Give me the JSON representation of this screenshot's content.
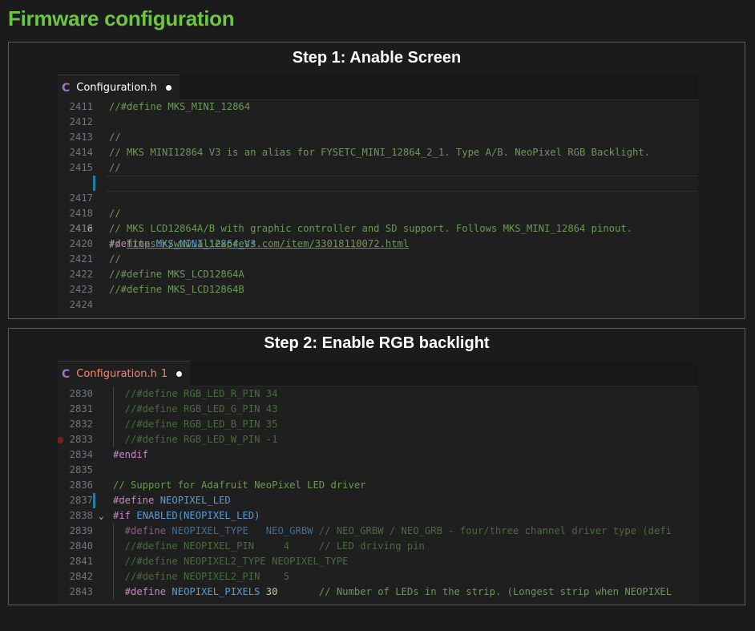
{
  "page_title": "Firmware configuration",
  "steps": [
    {
      "title": "Step 1: Anable Screen",
      "tab": {
        "icon": "C",
        "label": "Configuration.h",
        "badge": ""
      },
      "lines": [
        {
          "n": "2411",
          "t": "//#define MKS_MINI_12864"
        },
        {
          "n": "2412",
          "t": ""
        },
        {
          "n": "2413",
          "t": "//"
        },
        {
          "n": "2414",
          "t": "// MKS MINI12864 V3 is an alias for FYSETC_MINI_12864_2_1. Type A/B. NeoPixel RGB Backlight."
        },
        {
          "n": "2415",
          "t": "//"
        },
        {
          "n": "2416",
          "kw": "#define",
          "mac": "MKS_MINI_12864_V3"
        },
        {
          "n": "2417",
          "t": ""
        },
        {
          "n": "2418",
          "t": "//"
        },
        {
          "n": "2419",
          "t": "// MKS LCD12864A/B with graphic controller and SD support. Follows MKS_MINI_12864 pinout."
        },
        {
          "n": "2420",
          "pre": "// ",
          "link": "https://www.aliexpress.com/item/33018110072.html"
        },
        {
          "n": "2421",
          "t": "//"
        },
        {
          "n": "2422",
          "t": "//#define MKS_LCD12864A"
        },
        {
          "n": "2423",
          "t": "//#define MKS_LCD12864B"
        },
        {
          "n": "2424",
          "t": ""
        }
      ]
    },
    {
      "title": "Step 2: Enable RGB backlight",
      "tab": {
        "icon": "C",
        "label": "Configuration.h",
        "badge": "1"
      },
      "lines": [
        {
          "n": "2830",
          "t": "  //#define RGB_LED_R_PIN 34"
        },
        {
          "n": "2831",
          "t": "  //#define RGB_LED_G_PIN 43"
        },
        {
          "n": "2832",
          "t": "  //#define RGB_LED_B_PIN 35"
        },
        {
          "n": "2833",
          "t": "  //#define RGB_LED_W_PIN -1"
        },
        {
          "n": "2834",
          "kw": "#endif"
        },
        {
          "n": "2835",
          "t": ""
        },
        {
          "n": "2836",
          "t": "// Support for Adafruit NeoPixel LED driver"
        },
        {
          "n": "2837",
          "kw": "#define",
          "mac": "NEOPIXEL_LED"
        },
        {
          "n": "2838",
          "kw": "#if",
          "mac": "ENABLED(NEOPIXEL_LED)"
        },
        {
          "n": "2839",
          "kw": "  #define",
          "mac": "NEOPIXEL_TYPE   NEO_GRBW",
          "com": " // NEO_GRBW / NEO_GRB - four/three channel driver type (defi"
        },
        {
          "n": "2840",
          "t": "  //#define NEOPIXEL_PIN     4     // LED driving pin"
        },
        {
          "n": "2841",
          "t": "  //#define NEOPIXEL2_TYPE NEOPIXEL_TYPE"
        },
        {
          "n": "2842",
          "t": "  //#define NEOPIXEL2_PIN    5"
        },
        {
          "n": "2843",
          "kw": "  #define",
          "mac": "NEOPIXEL_PIXELS",
          "num": " 30",
          "com": "       // Number of LEDs in the strip. (Longest strip when NEOPIXEL"
        }
      ]
    }
  ]
}
